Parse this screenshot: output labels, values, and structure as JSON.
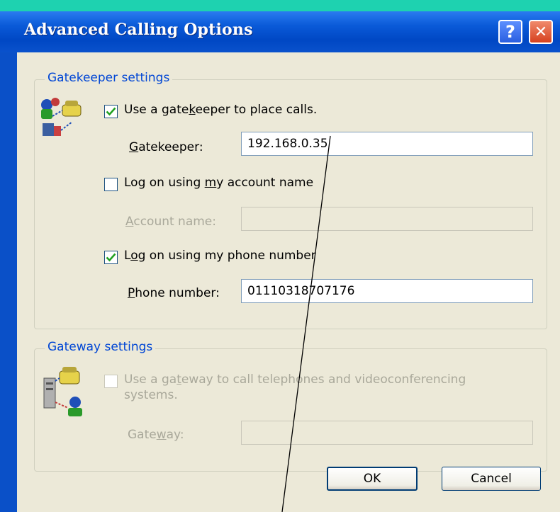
{
  "dialog": {
    "title": "Advanced Calling Options",
    "help_glyph": "?",
    "close_glyph": "✕"
  },
  "gatekeeper": {
    "group_title": "Gatekeeper settings",
    "use_gatekeeper": {
      "pre": "Use a gate",
      "accel": "k",
      "post": "eeper to place calls.",
      "checked": true
    },
    "gatekeeper_label": {
      "accel": "G",
      "post": "atekeeper:"
    },
    "gatekeeper_value": "192.168.0.35",
    "account_logon": {
      "pre": "Log on using ",
      "accel": "m",
      "post": "y account name",
      "checked": false
    },
    "account_label": {
      "accel": "A",
      "post": "ccount name:"
    },
    "account_value": "",
    "phone_logon": {
      "pre": "L",
      "accel": "o",
      "post": "g on using my phone number",
      "checked": true
    },
    "phone_label": {
      "accel": "P",
      "post": "hone number:"
    },
    "phone_value": "01110318707176"
  },
  "gateway": {
    "group_title": "Gateway settings",
    "use_gateway": {
      "line1_pre": "Use a ga",
      "accel": "t",
      "line1_post": "eway to call telephones and videoconferencing",
      "line2": "systems.",
      "checked": false
    },
    "gateway_label": {
      "pre": "Gate",
      "accel": "w",
      "post": "ay:"
    },
    "gateway_value": ""
  },
  "buttons": {
    "ok": "OK",
    "cancel": "Cancel"
  },
  "colors": {
    "title_bar": "#0047c4",
    "accent_strip": "#1ed2b0",
    "group_title": "#0046d5",
    "client_bg": "#ece9d8",
    "check": "#21a121"
  }
}
